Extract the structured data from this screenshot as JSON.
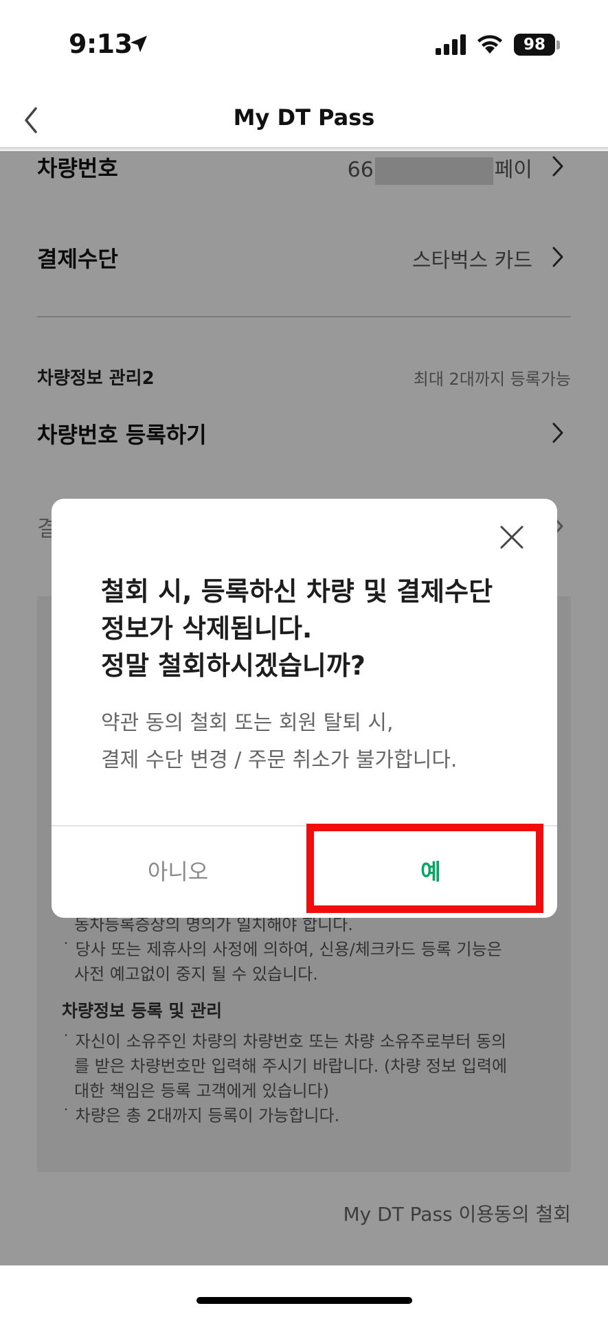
{
  "status": {
    "time": "9:13",
    "battery": "98"
  },
  "nav": {
    "title": "My DT Pass"
  },
  "vehicle": {
    "plate_label": "차량번호",
    "plate_prefix": "66",
    "plate_suffix": "페이",
    "payment_label": "결제수단",
    "payment_value": "스타벅스 카드",
    "section2_title": "차량정보 관리2",
    "section2_note": "최대 2대까지 등록가능",
    "register_label": "차량번호 등록하기",
    "partial_label": "결"
  },
  "notes": {
    "line1": "동차등록증상의 명의가 일치해야 합니다.",
    "line2": "˙ 당사 또는 제휴사의 사정에 의하여, 신용/체크카드 등록 기능은",
    "line3": "사전 예고없이 중지 될 수 있습니다.",
    "subtitle": "차량정보 등록 및 관리",
    "line4": "˙ 자신이 소유주인 차량의 차량번호 또는 차량 소유주로부터 동의",
    "line5": "를 받은 차량번호만 입력해 주시기 바랍니다. (차량 정보 입력에",
    "line6": "대한 책임은 등록 고객에게 있습니다)",
    "line7": "˙ 차량은 총 2대까지 등록이 가능합니다."
  },
  "withdraw_link": "My DT Pass 이용동의 철회",
  "modal": {
    "title_line1": "철회 시, 등록하신 차량 및 결제수단",
    "title_line2": "정보가 삭제됩니다.",
    "title_line3": "정말 철회하시겠습니까?",
    "desc_line1": "약관 동의 철회 또는 회원 탈퇴 시,",
    "desc_line2": "결제 수단 변경 / 주문 취소가 불가합니다.",
    "no_label": "아니오",
    "yes_label": "예"
  },
  "colors": {
    "accent": "#00a862",
    "highlight": "#f20d0d"
  }
}
